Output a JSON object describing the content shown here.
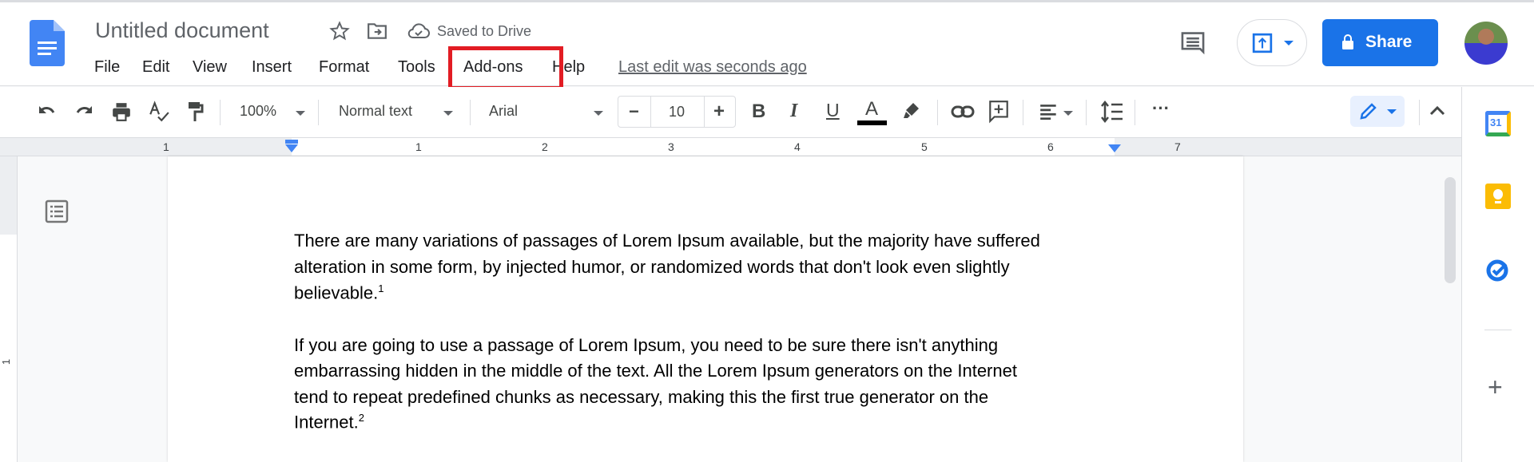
{
  "header": {
    "doc_title": "Untitled document",
    "save_status": "Saved to Drive",
    "menu": [
      "File",
      "Edit",
      "View",
      "Insert",
      "Format",
      "Tools",
      "Add-ons",
      "Help"
    ],
    "last_edit": "Last edit was seconds ago",
    "highlighted_menu": "Add-ons",
    "highlight_color": "#e21c23",
    "share_label": "Share",
    "accent_color": "#1a73e8"
  },
  "toolbar": {
    "zoom": "100%",
    "style": "Normal text",
    "font": "Arial",
    "font_size": "10",
    "minus": "−",
    "plus": "+",
    "bold": "B",
    "italic": "I",
    "underline": "U",
    "text_color": "A",
    "more": "···"
  },
  "ruler": {
    "labels": [
      "1",
      "1",
      "2",
      "3",
      "4",
      "5",
      "6",
      "7"
    ],
    "vertical_label": "1"
  },
  "document": {
    "paragraphs": [
      {
        "lines": [
          "There are many variations of passages of Lorem Ipsum available, but the majority have suffered",
          "alteration in some form, by injected humor, or randomized words that don't look even slightly",
          "believable."
        ],
        "footnote": "1"
      },
      {
        "lines": [
          "If you are going to use a passage of Lorem Ipsum, you need to be sure there isn't anything",
          "embarrassing hidden in the middle of the text. All the Lorem Ipsum generators on the Internet",
          "tend to repeat predefined chunks as necessary, making this the first true generator on the",
          "Internet."
        ],
        "footnote": "2"
      }
    ]
  },
  "side_panel": {
    "calendar_day": "31",
    "apps": [
      "calendar-icon",
      "keep-icon",
      "tasks-icon"
    ],
    "add": "+"
  }
}
